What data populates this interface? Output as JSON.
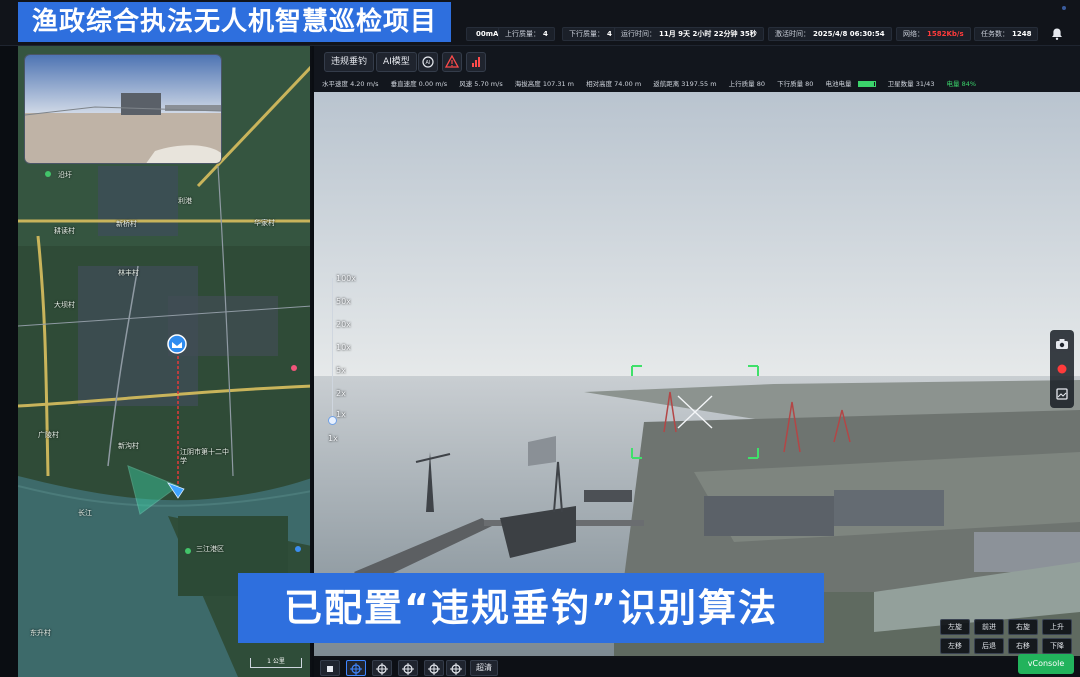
{
  "header": {
    "title": "渔政综合执法无人机智慧巡检项目",
    "stats": [
      {
        "label": "",
        "value": "00mA"
      },
      {
        "label": "上行质量：",
        "value": "4"
      },
      {
        "label": "下行质量：",
        "value": "4"
      },
      {
        "label": "运行时间：",
        "value": "11月 9天 2小时 22分钟 35秒"
      },
      {
        "label": "激活时间：",
        "value": "2025/4/8 06:30:54"
      },
      {
        "label": "网络：",
        "value": "1582Kb/s"
      },
      {
        "label": "任务数：",
        "value": "1248"
      }
    ]
  },
  "toolbar": {
    "buttons": [
      "违规垂钓",
      "AI模型"
    ],
    "icons": [
      "ai-detect-icon",
      "warning-icon",
      "signal-icon"
    ]
  },
  "telemetry": [
    "水平速度 4.20 m/s",
    "垂直速度 0.00 m/s",
    "风速 5.70 m/s",
    "海拔高度 107.31 m",
    "相对高度 74.00 m",
    "返航距离 3197.55 m",
    "上行质量 80",
    "下行质量 80",
    "电池电量",
    "卫星数量 31/43",
    "电量 84%"
  ],
  "zoom": {
    "levels": [
      "100x",
      "50x",
      "20x",
      "10x",
      "5x",
      "2x",
      "1x",
      "1x"
    ],
    "current": "1x"
  },
  "ptz": {
    "row1": [
      "左旋",
      "前进",
      "右旋",
      "上升"
    ],
    "row2": [
      "左移",
      "后退",
      "右移",
      "下降"
    ]
  },
  "bottom": {
    "quality_label": "超清",
    "vconsole_label": "vConsole"
  },
  "map": {
    "labels": [
      "沿圩",
      "利港",
      "新桥村",
      "华家村",
      "耕读村",
      "林丰村",
      "大坝村",
      "江阴市第十二中学",
      "长江",
      "三江港区",
      "广陵村",
      "新沟村",
      "东升村"
    ],
    "scale_label": "1 公里"
  },
  "caption": "已配置“违规垂钓”识别算法",
  "colors": {
    "accent": "#2e6fde",
    "ok": "#22b35c",
    "alert": "#ff3b3b"
  }
}
